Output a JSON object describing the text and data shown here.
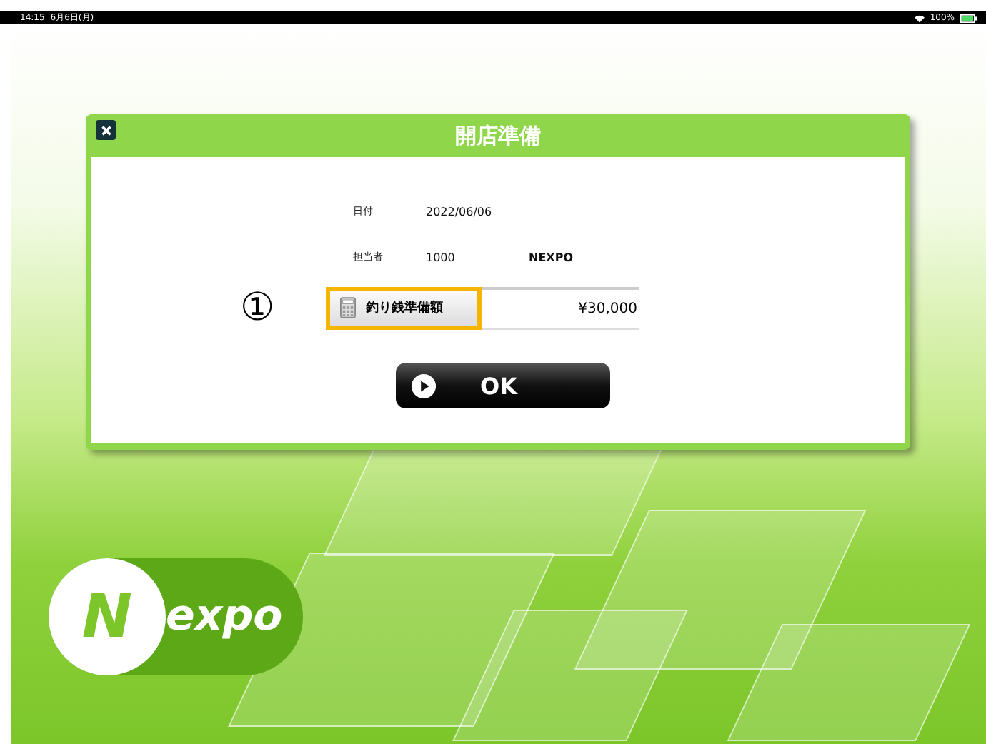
{
  "status_bar": {
    "time": "14:15",
    "date": "6月6日(月)",
    "battery": "100%"
  },
  "dialog": {
    "title": "開店準備",
    "fields": [
      {
        "label": "日付",
        "values": [
          "2022/06/06"
        ]
      },
      {
        "label": "担当者",
        "values": [
          "1000",
          "NEXPO"
        ]
      }
    ],
    "annotation": "①",
    "amount": {
      "label": "釣り銭準備額",
      "value": "¥30,000",
      "selected": true
    },
    "ok_button": "OK"
  },
  "logo": {
    "initial": "N",
    "rest": "expo"
  }
}
